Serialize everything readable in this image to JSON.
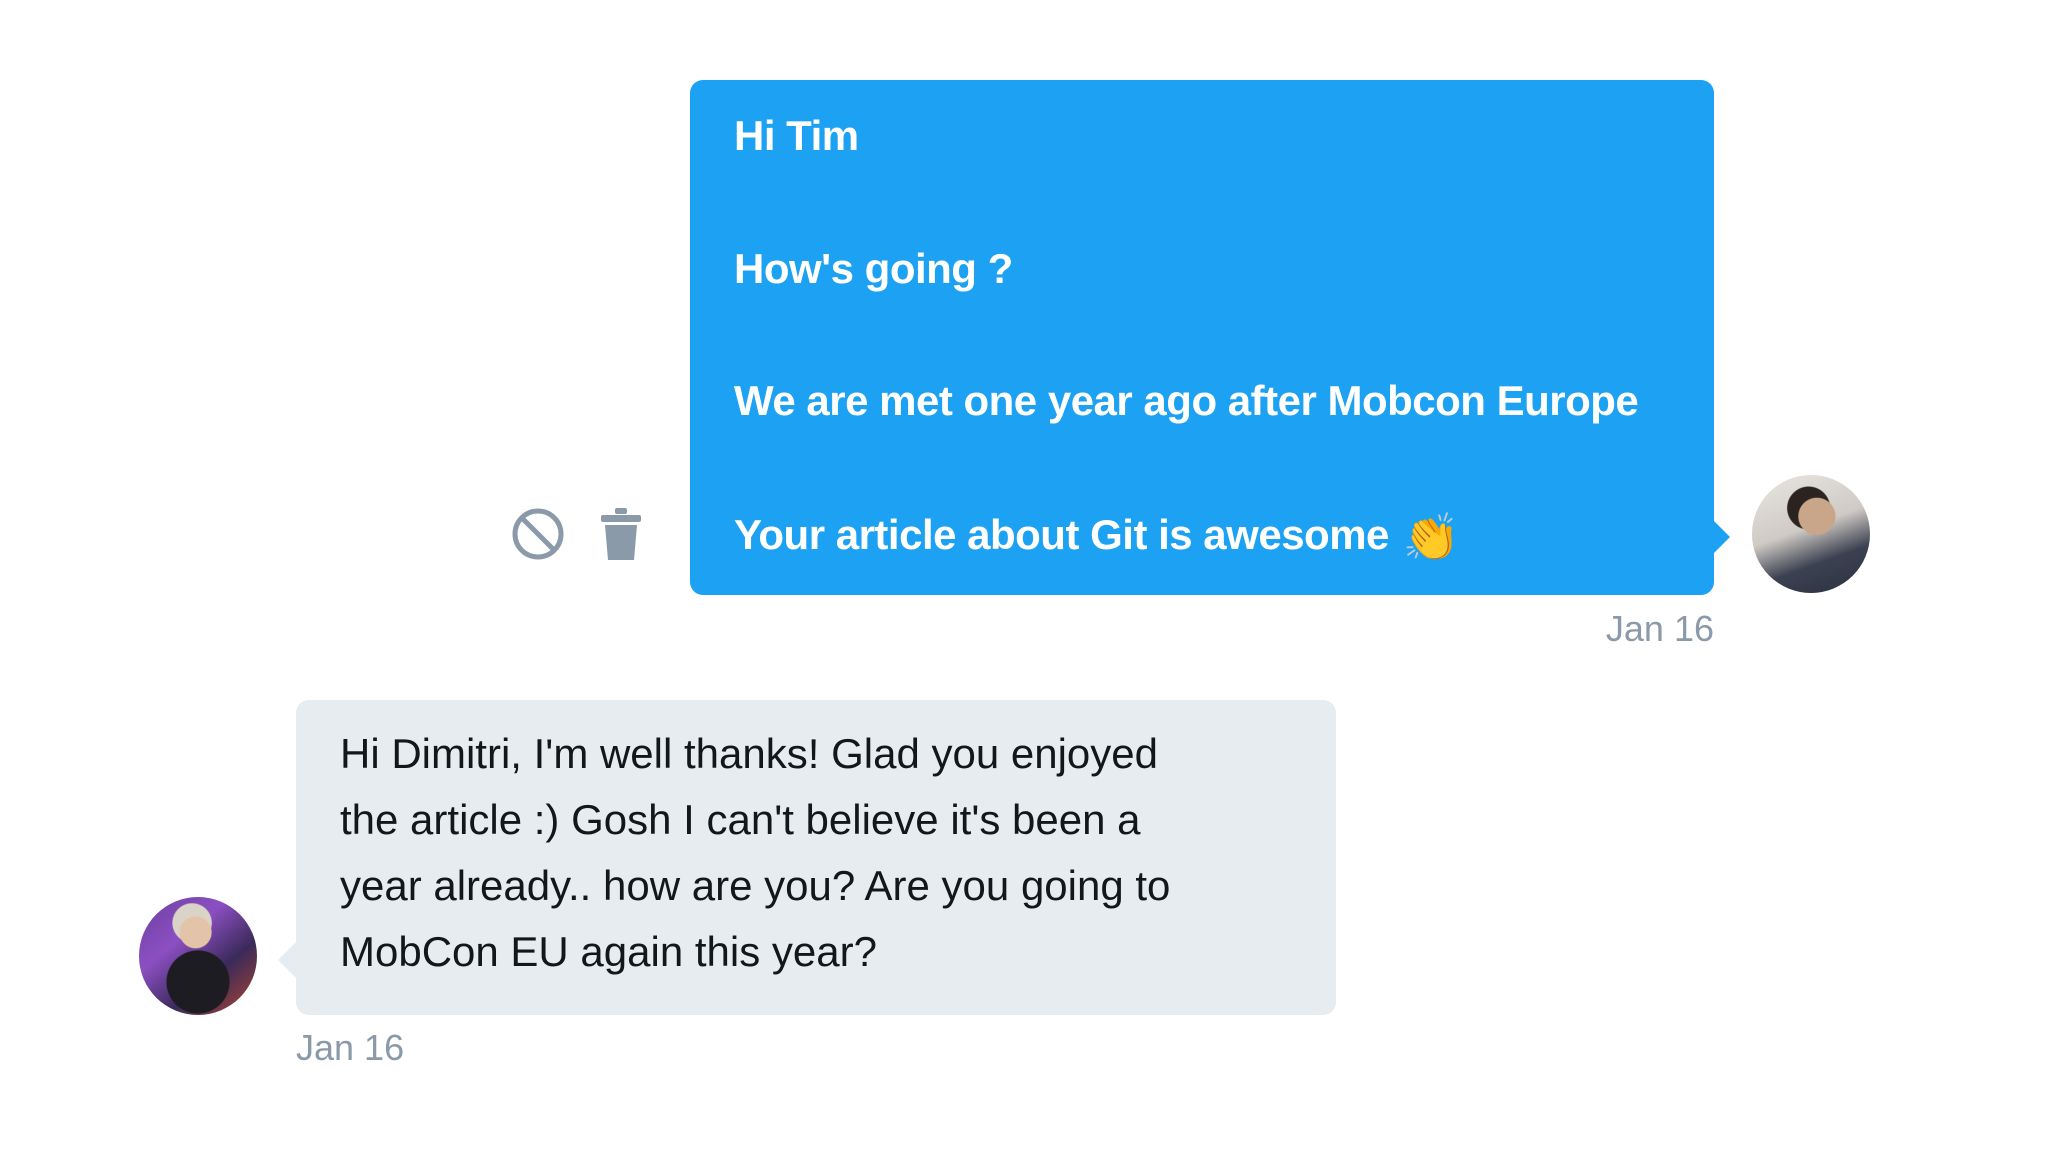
{
  "conversation": {
    "sent": {
      "lines": [
        "Hi Tim",
        "How's going ?",
        "We are met one year ago after Mobcon Europe",
        "Your article about Git is awesome"
      ],
      "emoji": "👏",
      "timestamp": "Jan 16",
      "avatar_icon": "user-avatar"
    },
    "received": {
      "lines": [
        "Hi Dimitri, I'm well thanks! Glad you enjoyed",
        "the article :) Gosh I can't believe it's been a",
        "year already.. how are you? Are you going to",
        "MobCon EU again this year?"
      ],
      "timestamp": "Jan 16",
      "avatar_icon": "user-avatar"
    },
    "actions": {
      "block_icon": "block-icon",
      "delete_icon": "trash-icon"
    },
    "colors": {
      "sent_bubble": "#1da1f2",
      "received_bubble": "#e6ecf0",
      "timestamp": "#8a9aa8",
      "icon": "#8a9aa8"
    }
  }
}
